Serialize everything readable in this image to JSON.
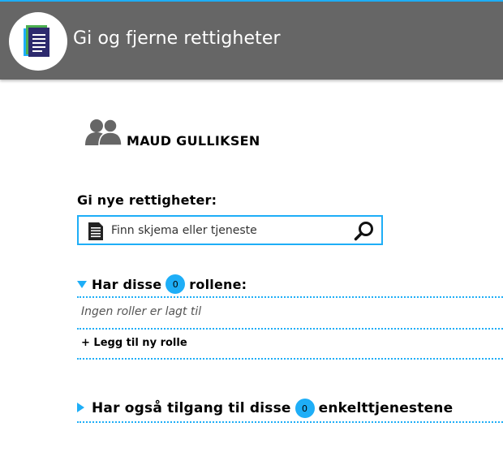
{
  "header": {
    "title": "Gi og fjerne rettigheter",
    "logo_icon": "documents-icon"
  },
  "user": {
    "icon": "persons-icon",
    "name": "MAUD GULLIKSEN"
  },
  "give_rights": {
    "label": "Gi nye rettigheter:",
    "search_placeholder": "Finn skjema eller tjeneste",
    "search_value": "",
    "doc_icon": "document-icon",
    "search_icon": "magnifier-icon"
  },
  "roles_section": {
    "prefix": "Har disse",
    "count": "0",
    "suffix": "rollene:",
    "expanded": true,
    "empty_text": "Ingen roller er lagt til",
    "add_label": "+ Legg til ny rolle"
  },
  "services_section": {
    "prefix": "Har også tilgang til disse",
    "count": "0",
    "suffix": "enkelttjenestene",
    "expanded": false
  },
  "colors": {
    "accent": "#1eaef7",
    "header_bg": "#666666"
  }
}
